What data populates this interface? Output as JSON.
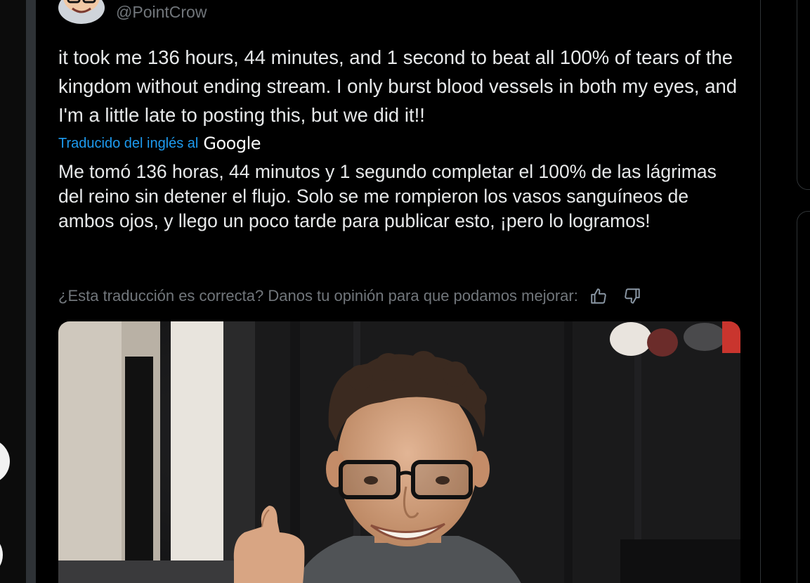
{
  "tweet": {
    "handle": "@PointCrow",
    "text": "it took me 136 hours, 44 minutes, and 1 second to beat all 100% of tears of the kingdom without ending stream. I only burst blood vessels in both my eyes, and I'm a little late to posting this, but we did it!!",
    "translated_label": "Traducido del inglés al",
    "translator_brand": "Google",
    "translation": "Me tomó 136 horas, 44 minutos y 1 segundo completar el 100% de las lágrimas del reino sin detener el flujo. Solo se me rompieron los vasos sanguíneos de ambos ojos, y llego un poco tarde para publicar esto, ¡pero lo logramos!",
    "feedback_prompt": "¿Esta traducción es correcta? Danos tu opinión para que podamos mejorar:"
  },
  "icons": {
    "thumbs_up": "thumbs-up-icon",
    "thumbs_down": "thumbs-down-icon"
  },
  "colors": {
    "background": "#000000",
    "text_primary": "#e7e9ea",
    "text_secondary": "#71767b",
    "link_blue": "#1d9bf0",
    "border": "#2f3336"
  }
}
